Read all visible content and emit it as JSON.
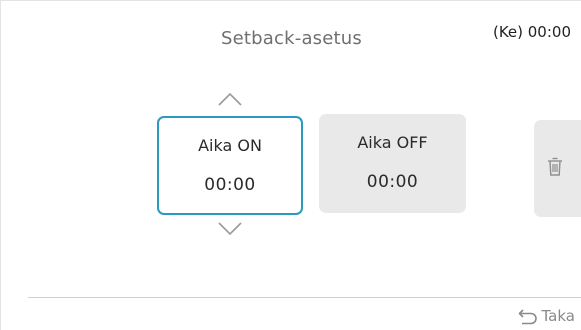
{
  "header": {
    "title": "Setback-asetus",
    "clock": "(Ke) 00:00"
  },
  "timers": {
    "on": {
      "label": "Aika ON",
      "value": "00:00",
      "selected": true
    },
    "off": {
      "label": "Aika OFF",
      "value": "00:00",
      "selected": false
    }
  },
  "icons": {
    "up": "chevron-up-icon",
    "down": "chevron-down-icon",
    "delete": "trash-icon",
    "back": "back-arrow-icon"
  },
  "footer": {
    "back_label": "Taka"
  },
  "colors": {
    "accent": "#2a9bbf",
    "card_background": "#e9e9e9",
    "title_text": "#6f6f6f"
  }
}
